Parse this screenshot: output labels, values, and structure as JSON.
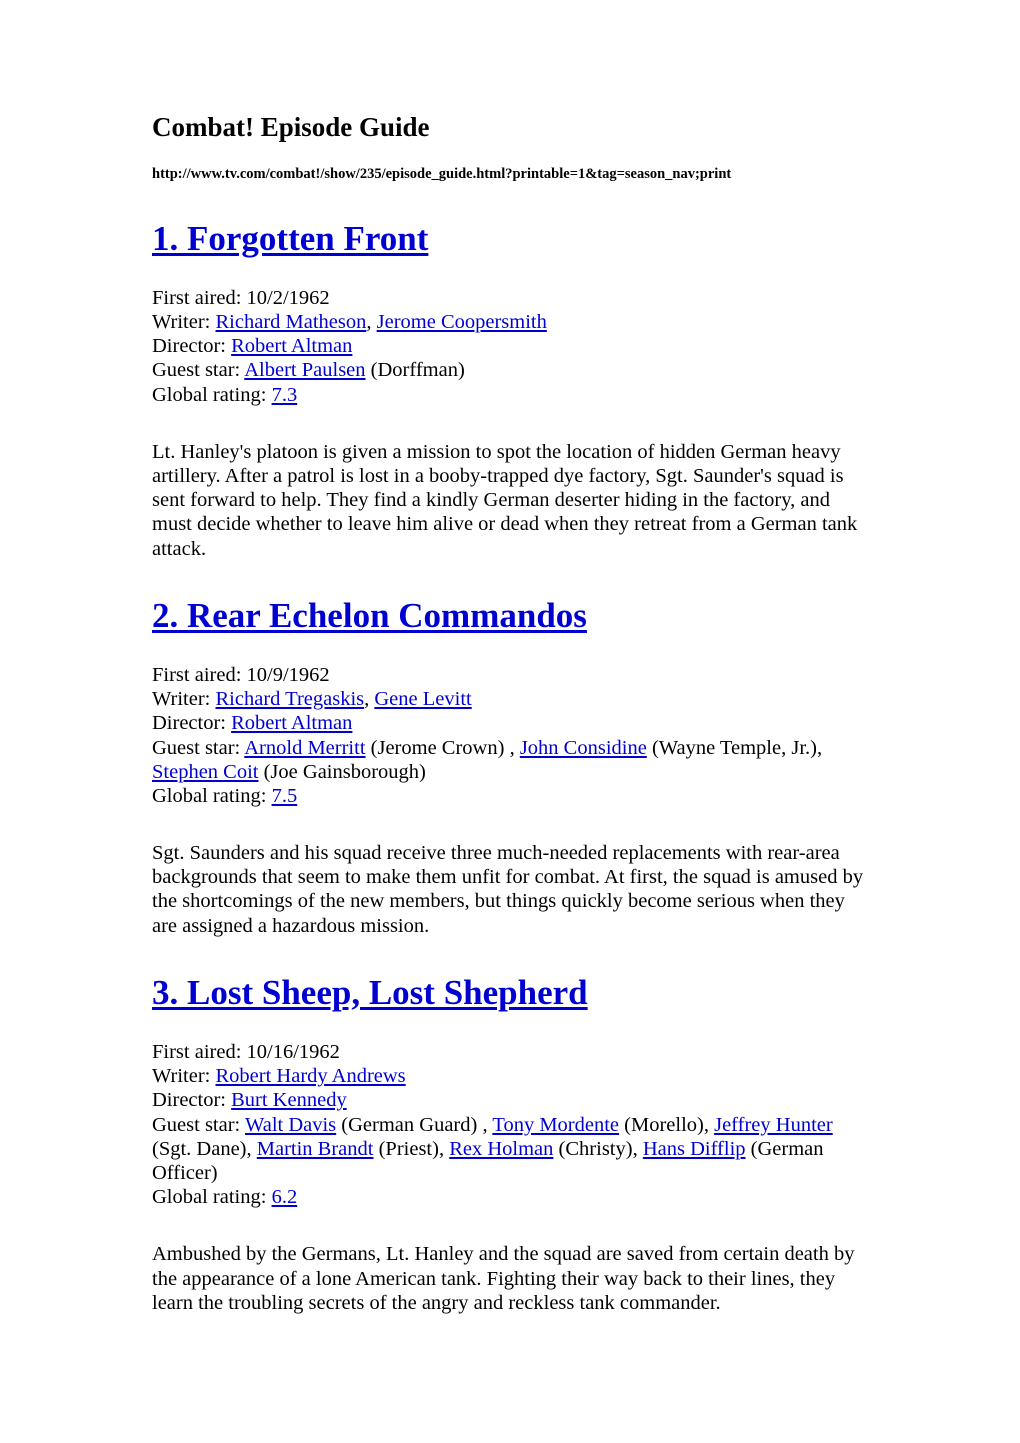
{
  "document": {
    "title": "Combat! Episode Guide",
    "url": "http://www.tv.com/combat!/show/235/episode_guide.html?printable=1&tag=season_nav;print",
    "link_color": "#0000d0",
    "text_color": "#000000",
    "background_color": "#ffffff"
  },
  "labels": {
    "first_aired": "First aired:",
    "writer": "Writer:",
    "director": "Director:",
    "guest_star": "Guest star:",
    "global_rating": "Global rating:"
  },
  "episodes": [
    {
      "number": "1.",
      "title": "Forgotten Front",
      "heading": "1. Forgotten Front ",
      "first_aired": "10/2/1962",
      "writers": [
        "Richard Matheson",
        "Jerome Coopersmith"
      ],
      "writers_line": "Richard Matheson, Jerome Coopersmith",
      "directors": [
        "Robert Altman"
      ],
      "directors_line": "Robert Altman",
      "guest_stars": [
        {
          "name": "Albert Paulsen",
          "role": "(Dorffman)"
        }
      ],
      "guest_star_line": "Albert Paulsen (Dorffman)",
      "global_rating": "7.3",
      "description": "Lt. Hanley's platoon is given a mission to spot the location of hidden German heavy artillery. After a patrol is lost in a booby-trapped dye factory, Sgt. Saunder's squad is sent forward to help. They find a kindly German deserter hiding in the factory, and must decide whether to leave him alive or dead when they retreat from a German tank attack."
    },
    {
      "number": "2.",
      "title": "Rear Echelon Commandos",
      "heading": "2. Rear Echelon Commandos ",
      "first_aired": "10/9/1962",
      "writers": [
        "Richard Tregaskis",
        "Gene Levitt"
      ],
      "writers_line": "Richard Tregaskis, Gene Levitt",
      "directors": [
        "Robert Altman"
      ],
      "directors_line": "Robert Altman",
      "guest_stars": [
        {
          "name": "Arnold Merritt",
          "role": "(Jerome Crown)"
        },
        {
          "name": "John Considine",
          "role": "(Wayne Temple, Jr.)"
        },
        {
          "name": "Stephen Coit",
          "role": "(Joe Gainsborough)"
        }
      ],
      "guest_star_line": "Arnold Merritt (Jerome Crown) , John Considine (Wayne Temple, Jr.), Stephen Coit (Joe Gainsborough)",
      "global_rating": "7.5",
      "description": "Sgt. Saunders and his squad receive three much-needed replacements with rear-area backgrounds that seem to make them unfit for combat. At first, the squad is amused by the shortcomings of the new members, but things quickly become serious when they are assigned a hazardous mission."
    },
    {
      "number": "3.",
      "title": "Lost Sheep, Lost Shepherd",
      "heading": "3. Lost Sheep, Lost Shepherd ",
      "first_aired": "10/16/1962",
      "writers": [
        "Robert Hardy Andrews"
      ],
      "writers_line": "Robert Hardy Andrews",
      "directors": [
        "Burt Kennedy"
      ],
      "directors_line": "Burt Kennedy",
      "guest_stars": [
        {
          "name": "Walt Davis",
          "role": "(German Guard)"
        },
        {
          "name": "Tony Mordente",
          "role": "(Morello)"
        },
        {
          "name": "Jeffrey Hunter ",
          "role": "(Sgt. Dane)"
        },
        {
          "name": "Martin Brandt",
          "role": "(Priest)"
        },
        {
          "name": "Rex Holman",
          "role": "(Christy)"
        },
        {
          "name": "Hans Difflip",
          "role": "(German Officer)"
        }
      ],
      "guest_star_line": "Walt Davis (German Guard) , Tony Mordente (Morello), Jeffrey Hunter (Sgt. Dane), Martin Brandt (Priest), Rex Holman (Christy), Hans Difflip (German Officer)",
      "global_rating": "6.2",
      "description": "Ambushed by the Germans, Lt. Hanley and the squad are saved from certain death by the appearance of a lone American tank. Fighting their way back to their lines, they learn the troubling secrets of the angry and reckless tank commander."
    }
  ]
}
